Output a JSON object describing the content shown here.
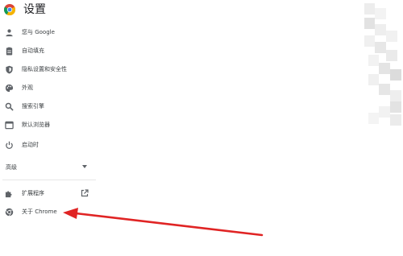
{
  "header": {
    "title": "设置"
  },
  "menu": {
    "items": [
      {
        "label": "您与 Google",
        "icon": "person-icon"
      },
      {
        "label": "自动填充",
        "icon": "clipboard-icon"
      },
      {
        "label": "隐私设置和安全性",
        "icon": "shield-icon"
      },
      {
        "label": "外观",
        "icon": "palette-icon"
      },
      {
        "label": "搜索引擎",
        "icon": "search-icon"
      },
      {
        "label": "默认浏览器",
        "icon": "browser-window-icon"
      },
      {
        "label": "启动时",
        "icon": "power-icon"
      }
    ],
    "advanced": {
      "label": "高级",
      "icon": "dropdown-arrow-icon"
    },
    "extensions": {
      "label": "扩展程序",
      "icon": "puzzle-icon",
      "link_icon": "external-link-icon"
    },
    "about": {
      "label": "关于 Chrome",
      "icon": "chrome-logo-icon"
    }
  },
  "colors": {
    "icon": "#5f6368",
    "text": "#3c4043",
    "annotation_arrow": "#e02424",
    "pixelation": [
      "#e9e9e9",
      "#f2f2f2",
      "#dddddd",
      "#f6f6f6"
    ]
  }
}
